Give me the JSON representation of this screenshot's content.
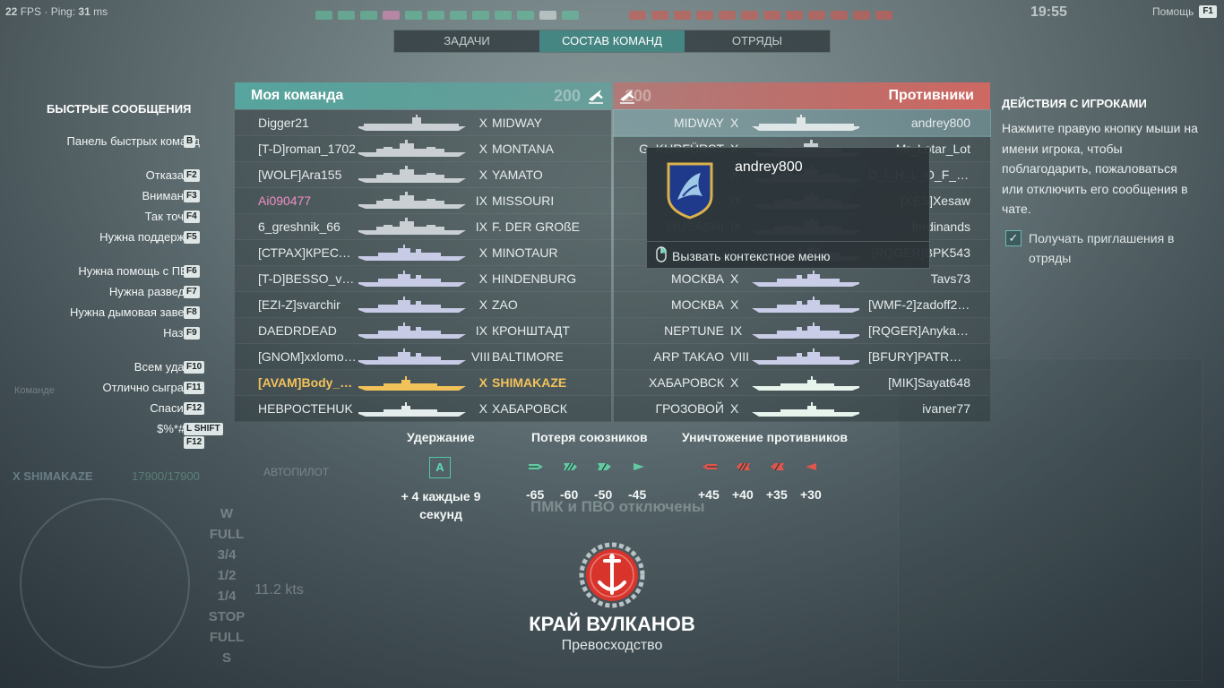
{
  "hud": {
    "fps_value": "22",
    "fps_label": "FPS · Ping:",
    "ping_value": "31",
    "ping_unit": "ms",
    "clock": "19:55",
    "help_label": "Помощь",
    "help_key": "F1"
  },
  "tabs": [
    {
      "label": "ЗАДАЧИ",
      "active": false
    },
    {
      "label": "СОСТАВ КОМАНД",
      "active": true
    },
    {
      "label": "ОТРЯДЫ",
      "active": false
    }
  ],
  "quick_messages": {
    "title": "БЫСТРЫЕ СООБЩЕНИЯ",
    "items": [
      {
        "label": "Панель быстрых команд",
        "key": "B"
      },
      {
        "label": "Отказано.",
        "key": "F2"
      },
      {
        "label": "Внимание!",
        "key": "F3"
      },
      {
        "label": "Так точно!",
        "key": "F4"
      },
      {
        "label": "Нужна поддержка!",
        "key": "F5"
      },
      {
        "label": "Нужна помощь с ПВО!",
        "key": "F6"
      },
      {
        "label": "Нужна разведка!",
        "key": "F7"
      },
      {
        "label": "Нужна дымовая завеса!",
        "key": "F8"
      },
      {
        "label": "Назад!",
        "key": "F9"
      },
      {
        "label": "Всем удачи!",
        "key": "F10"
      },
      {
        "label": "Отлично сыграно!",
        "key": "F11"
      },
      {
        "label": "Спасибо!",
        "key": "F12"
      },
      {
        "label": "$%*#@!",
        "key": "L SHIFT",
        "key2": "F12"
      }
    ]
  },
  "ally_team": {
    "title": "Моя команда",
    "score": "200",
    "players": [
      {
        "name": "Digger21",
        "tier": "X",
        "ship": "MIDWAY",
        "type": "carrier"
      },
      {
        "name": "[T-D]roman_1702",
        "tier": "X",
        "ship": "MONTANA",
        "type": "battleship"
      },
      {
        "name": "[WOLF]Ara155",
        "tier": "X",
        "ship": "YAMATO",
        "type": "battleship"
      },
      {
        "name": "Ai090477",
        "tier": "IX",
        "ship": "MISSOURI",
        "type": "battleship",
        "style": "pink"
      },
      {
        "name": "6_greshnik_66",
        "tier": "IX",
        "ship": "F. DER GROßE",
        "type": "battleship"
      },
      {
        "name": "[СТРАХ]КРЕСТОНОС...",
        "tier": "X",
        "ship": "MINOTAUR",
        "type": "cruiser"
      },
      {
        "name": "[T-D]BESSO_voin",
        "tier": "X",
        "ship": "HINDENBURG",
        "type": "cruiser"
      },
      {
        "name": "[EZI-Z]svarchir",
        "tier": "X",
        "ship": "ZAO",
        "type": "cruiser"
      },
      {
        "name": "DAEDRDEAD",
        "tier": "IX",
        "ship": "КРОНШТАДТ",
        "type": "cruiser"
      },
      {
        "name": "[GNOM]xxlomomxx",
        "tier": "VIII",
        "ship": "BALTIMORE",
        "type": "cruiser"
      },
      {
        "name": "[AVAM]Body_Bag",
        "tier": "X",
        "ship": "SHIMAKAZE",
        "type": "destroyer",
        "style": "self"
      },
      {
        "name": "НЕВРОСТЕНUK",
        "tier": "X",
        "ship": "ХАБАРОВСК",
        "type": "destroyer"
      }
    ]
  },
  "enemy_team": {
    "title": "Противники",
    "score": "200",
    "players": [
      {
        "name": "andrey800",
        "tier": "X",
        "ship": "MIDWAY",
        "type": "carrier",
        "style": "hl"
      },
      {
        "name": "Mr_Lotar_Lot",
        "tier": "X",
        "ship": "G. KURFÜRST",
        "type": "battleship"
      },
      {
        "name": "D_I_H_L_O_F_O_S_",
        "tier": "X",
        "ship": "",
        "type": "battleship"
      },
      {
        "name": "[XES]Xesaw",
        "tier": "IX",
        "ship": "",
        "type": "battleship"
      },
      {
        "name": "ferdinands",
        "tier": "IX",
        "ship": "MUSASHI",
        "type": "battleship"
      },
      {
        "name": "[RQGER]BPK543",
        "tier": "",
        "ship": "",
        "type": "cruiser"
      },
      {
        "name": "Tavs73",
        "tier": "X",
        "ship": "МОСКВА",
        "type": "cruiser"
      },
      {
        "name": "[WMF-2]zadoff2014",
        "tier": "X",
        "ship": "МОСКВА",
        "type": "cruiser"
      },
      {
        "name": "[RQGER]AnykaNaka7...",
        "tier": "IX",
        "ship": "NEPTUNE",
        "type": "cruiser"
      },
      {
        "name": "[BFURY]PATRON_12...",
        "tier": "VIII",
        "ship": "ARP TAKAO",
        "type": "cruiser"
      },
      {
        "name": "[MIK]Sayat648",
        "tier": "X",
        "ship": "ХАБАРОВСК",
        "type": "destroyer"
      },
      {
        "name": "ivaner77",
        "tier": "X",
        "ship": "ГРОЗОВОЙ",
        "type": "destroyer"
      }
    ]
  },
  "popup": {
    "player_name": "andrey800",
    "action_label": "Вызвать контекстное меню"
  },
  "player_actions": {
    "title": "ДЕЙСТВИЯ С ИГРОКАМИ",
    "text": "Нажмите правую кнопку мыши на имени игрока, чтобы поблагодарить, пожаловаться или отключить его сообщения в чате.",
    "checkbox_label": "Получать приглашения в отряды",
    "checkbox_checked": true
  },
  "scoring": {
    "hold": {
      "title": "Удержание",
      "icon_label": "A",
      "value": "+ 4 каждые 9 секунд"
    },
    "ally_loss": {
      "title": "Потеря союзников",
      "values": [
        "-65",
        "-60",
        "-50",
        "-45"
      ]
    },
    "enemy_kill": {
      "title": "Уничтожение противников",
      "values": [
        "+45",
        "+40",
        "+35",
        "+30"
      ]
    }
  },
  "battle": {
    "map_name": "КРАЙ ВУЛКАНОВ",
    "mode": "Превосходство"
  },
  "background_hud": {
    "ship": "X SHIMAKAZE",
    "hp": "17900/17900",
    "speed_marks": [
      "W",
      "FULL",
      "3/4",
      "1/2",
      "1/4",
      "STOP",
      "FULL",
      "S"
    ],
    "speed": "11.2 kts",
    "aa_notice": "ПМК и ПВО отключены",
    "autopilot": "АВТОПИЛОТ",
    "command": "Команде"
  },
  "colors": {
    "ally": "#56a8a0",
    "enemy": "#d46862",
    "self": "#f2c25a",
    "accent": "#53c8a6"
  }
}
